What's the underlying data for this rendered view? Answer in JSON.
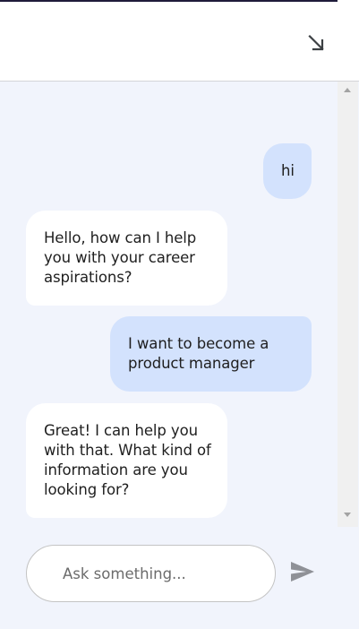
{
  "header": {
    "minimize_icon": "arrow-down-right-icon"
  },
  "messages": [
    {
      "role": "user",
      "text": "hi"
    },
    {
      "role": "bot",
      "text": "Hello, how can I help you with your career aspirations?"
    },
    {
      "role": "user",
      "text": "I want to become a product manager"
    },
    {
      "role": "bot",
      "text": "Great! I can help you with that. What kind of information are you looking for?"
    }
  ],
  "composer": {
    "placeholder": "Ask something...",
    "send_icon": "send-icon"
  },
  "colors": {
    "user_bubble": "#d3e2fd",
    "bot_bubble": "#ffffff",
    "chat_background": "#f1f4fc",
    "send_icon": "#8f9197"
  }
}
